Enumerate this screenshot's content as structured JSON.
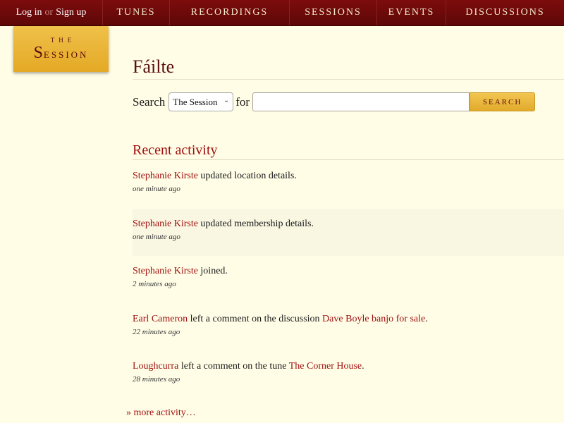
{
  "header": {
    "login_label": "Log in",
    "or_label": "or",
    "signup_label": "Sign up",
    "nav": [
      "TUNES",
      "RECORDINGS",
      "SESSIONS",
      "EVENTS",
      "DISCUSSIONS"
    ]
  },
  "logo": {
    "the": "THE",
    "name_cap": "S",
    "name_rest": "ESSION"
  },
  "page": {
    "title": "Fáilte"
  },
  "search": {
    "label": "Search",
    "scope_value": "The Session",
    "for_label": "for",
    "input_value": "",
    "button_label": "SEARCH"
  },
  "recent": {
    "title": "Recent activity",
    "items": [
      {
        "actor": "Stephanie Kirste",
        "text": " updated location details.",
        "target": "",
        "end": "",
        "time": "one minute ago"
      },
      {
        "actor": "Stephanie Kirste",
        "text": " updated membership details.",
        "target": "",
        "end": "",
        "time": "one minute ago"
      },
      {
        "actor": "Stephanie Kirste",
        "text": " joined.",
        "target": "",
        "end": "",
        "time": "2 minutes ago"
      },
      {
        "actor": "Earl Cameron",
        "text": " left a comment on the discussion ",
        "target": "Dave Boyle banjo for sale",
        "end": ".",
        "time": "22 minutes ago"
      },
      {
        "actor": "Loughcurra",
        "text": " left a comment on the tune ",
        "target": "The Corner House",
        "end": ".",
        "time": "28 minutes ago"
      }
    ],
    "more_label": "» more activity…"
  },
  "colors": {
    "nav_bg": "#6e0a0b",
    "page_bg": "#fffde6",
    "accent_gold": "#e9b43a",
    "link_red": "#a01112",
    "title_maroon": "#5a0d0d"
  }
}
